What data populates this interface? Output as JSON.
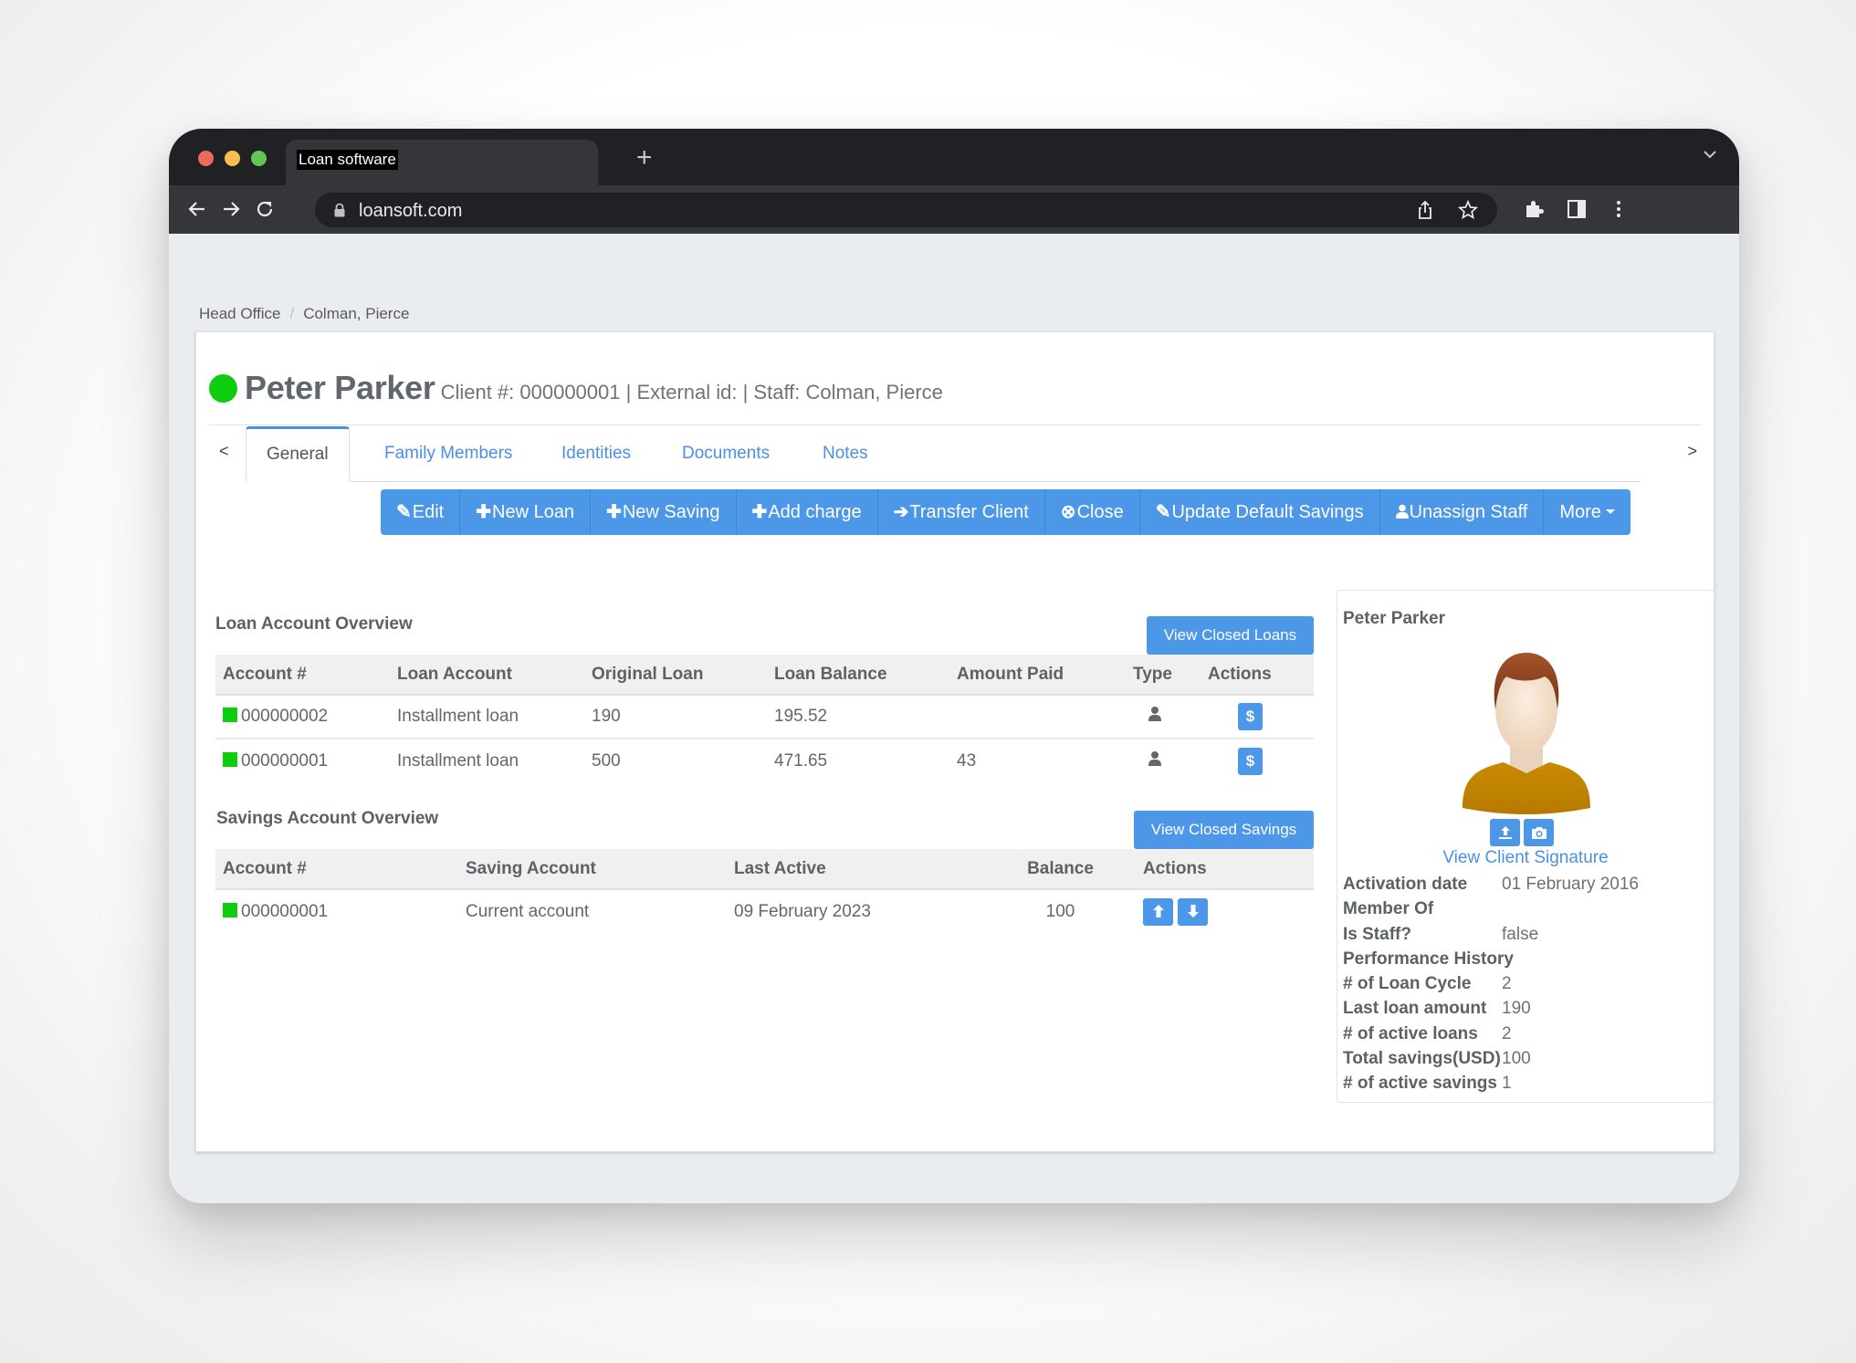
{
  "browser": {
    "tab_title": "Loan software",
    "url": "loansoft.com",
    "icons": [
      "back-icon",
      "forward-icon",
      "reload-icon",
      "lock-icon",
      "share-icon",
      "star-icon",
      "extensions-icon",
      "side-panel-icon",
      "menu-icon",
      "new-tab-icon",
      "tab-list-icon"
    ]
  },
  "breadcrumb": {
    "items": [
      "Head Office",
      "Colman, Pierce"
    ],
    "separator": "/"
  },
  "client": {
    "name": "Peter Parker",
    "meta": "Client #: 000000001 | External id: | Staff: Colman, Pierce",
    "status_color": "#0ecc0e"
  },
  "tabs": {
    "prev": "<",
    "next": ">",
    "items": [
      {
        "label": "General",
        "active": true
      },
      {
        "label": "Family Members",
        "active": false
      },
      {
        "label": "Identities",
        "active": false
      },
      {
        "label": "Documents",
        "active": false
      },
      {
        "label": "Notes",
        "active": false
      }
    ]
  },
  "actions": [
    {
      "icon": "✎",
      "icon_name": "edit-icon",
      "label": "Edit"
    },
    {
      "icon": "✚",
      "icon_name": "plus-icon",
      "label": "New Loan"
    },
    {
      "icon": "✚",
      "icon_name": "plus-icon",
      "label": "New Saving"
    },
    {
      "icon": "✚",
      "icon_name": "plus-icon",
      "label": "Add charge"
    },
    {
      "icon": "➔",
      "icon_name": "arrow-right-icon",
      "label": "Transfer Client"
    },
    {
      "icon": "⊗",
      "icon_name": "close-circle-icon",
      "label": "Close"
    },
    {
      "icon": "✎",
      "icon_name": "edit-icon",
      "label": "Update Default Savings"
    },
    {
      "icon": "👤",
      "icon_name": "user-icon",
      "label": "Unassign Staff"
    },
    {
      "icon": "",
      "icon_name": "",
      "label": "More"
    }
  ],
  "loans": {
    "title": "Loan Account Overview",
    "view_closed": "View Closed Loans",
    "columns": [
      "Account #",
      "Loan Account",
      "Original Loan",
      "Loan Balance",
      "Amount Paid",
      "Type",
      "Actions"
    ],
    "rows": [
      {
        "account": "000000002",
        "product": "Installment loan",
        "original": "190",
        "balance": "195.52",
        "paid": "",
        "type_icon": "person-icon",
        "action": "$"
      },
      {
        "account": "000000001",
        "product": "Installment loan",
        "original": "500",
        "balance": "471.65",
        "paid": "43",
        "type_icon": "person-icon",
        "action": "$"
      }
    ]
  },
  "savings": {
    "title": "Savings Account Overview",
    "view_closed": "View Closed Savings",
    "columns": [
      "Account #",
      "Saving Account",
      "Last Active",
      "Balance",
      "Actions"
    ],
    "rows": [
      {
        "account": "000000001",
        "product": "Current account",
        "last_active": "09 February 2023",
        "balance": "100"
      }
    ]
  },
  "sidebar": {
    "name": "Peter Parker",
    "signature_link": "View Client Signature",
    "info": [
      {
        "k": "Activation date",
        "v": "01 February 2016"
      },
      {
        "k": "Member Of",
        "v": ""
      },
      {
        "k": "Is Staff?",
        "v": "false"
      },
      {
        "k": "Performance History",
        "v": ""
      },
      {
        "k": "# of Loan Cycle",
        "v": "2"
      },
      {
        "k": "Last loan amount",
        "v": "190"
      },
      {
        "k": "# of active loans",
        "v": "2"
      },
      {
        "k": "Total savings(USD)",
        "v": "100"
      },
      {
        "k": "# of active savings",
        "v": "1"
      }
    ]
  },
  "colors": {
    "primary": "#4d97e8",
    "link": "#4a90e2",
    "active_green": "#0ecc0e"
  }
}
